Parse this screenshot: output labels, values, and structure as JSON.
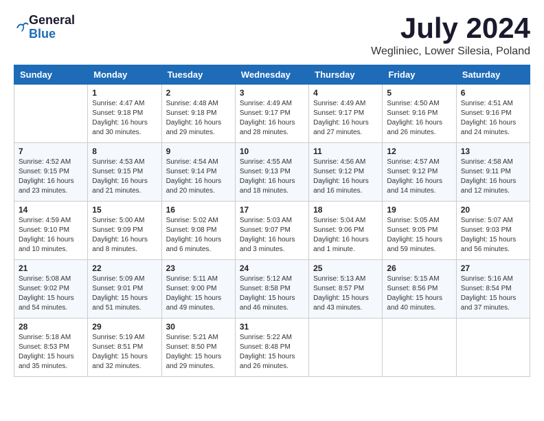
{
  "header": {
    "logo_general": "General",
    "logo_blue": "Blue",
    "month_year": "July 2024",
    "location": "Wegliniec, Lower Silesia, Poland"
  },
  "weekdays": [
    "Sunday",
    "Monday",
    "Tuesday",
    "Wednesday",
    "Thursday",
    "Friday",
    "Saturday"
  ],
  "weeks": [
    [
      {
        "day": "",
        "content": ""
      },
      {
        "day": "1",
        "content": "Sunrise: 4:47 AM\nSunset: 9:18 PM\nDaylight: 16 hours\nand 30 minutes."
      },
      {
        "day": "2",
        "content": "Sunrise: 4:48 AM\nSunset: 9:18 PM\nDaylight: 16 hours\nand 29 minutes."
      },
      {
        "day": "3",
        "content": "Sunrise: 4:49 AM\nSunset: 9:17 PM\nDaylight: 16 hours\nand 28 minutes."
      },
      {
        "day": "4",
        "content": "Sunrise: 4:49 AM\nSunset: 9:17 PM\nDaylight: 16 hours\nand 27 minutes."
      },
      {
        "day": "5",
        "content": "Sunrise: 4:50 AM\nSunset: 9:16 PM\nDaylight: 16 hours\nand 26 minutes."
      },
      {
        "day": "6",
        "content": "Sunrise: 4:51 AM\nSunset: 9:16 PM\nDaylight: 16 hours\nand 24 minutes."
      }
    ],
    [
      {
        "day": "7",
        "content": "Sunrise: 4:52 AM\nSunset: 9:15 PM\nDaylight: 16 hours\nand 23 minutes."
      },
      {
        "day": "8",
        "content": "Sunrise: 4:53 AM\nSunset: 9:15 PM\nDaylight: 16 hours\nand 21 minutes."
      },
      {
        "day": "9",
        "content": "Sunrise: 4:54 AM\nSunset: 9:14 PM\nDaylight: 16 hours\nand 20 minutes."
      },
      {
        "day": "10",
        "content": "Sunrise: 4:55 AM\nSunset: 9:13 PM\nDaylight: 16 hours\nand 18 minutes."
      },
      {
        "day": "11",
        "content": "Sunrise: 4:56 AM\nSunset: 9:12 PM\nDaylight: 16 hours\nand 16 minutes."
      },
      {
        "day": "12",
        "content": "Sunrise: 4:57 AM\nSunset: 9:12 PM\nDaylight: 16 hours\nand 14 minutes."
      },
      {
        "day": "13",
        "content": "Sunrise: 4:58 AM\nSunset: 9:11 PM\nDaylight: 16 hours\nand 12 minutes."
      }
    ],
    [
      {
        "day": "14",
        "content": "Sunrise: 4:59 AM\nSunset: 9:10 PM\nDaylight: 16 hours\nand 10 minutes."
      },
      {
        "day": "15",
        "content": "Sunrise: 5:00 AM\nSunset: 9:09 PM\nDaylight: 16 hours\nand 8 minutes."
      },
      {
        "day": "16",
        "content": "Sunrise: 5:02 AM\nSunset: 9:08 PM\nDaylight: 16 hours\nand 6 minutes."
      },
      {
        "day": "17",
        "content": "Sunrise: 5:03 AM\nSunset: 9:07 PM\nDaylight: 16 hours\nand 3 minutes."
      },
      {
        "day": "18",
        "content": "Sunrise: 5:04 AM\nSunset: 9:06 PM\nDaylight: 16 hours\nand 1 minute."
      },
      {
        "day": "19",
        "content": "Sunrise: 5:05 AM\nSunset: 9:05 PM\nDaylight: 15 hours\nand 59 minutes."
      },
      {
        "day": "20",
        "content": "Sunrise: 5:07 AM\nSunset: 9:03 PM\nDaylight: 15 hours\nand 56 minutes."
      }
    ],
    [
      {
        "day": "21",
        "content": "Sunrise: 5:08 AM\nSunset: 9:02 PM\nDaylight: 15 hours\nand 54 minutes."
      },
      {
        "day": "22",
        "content": "Sunrise: 5:09 AM\nSunset: 9:01 PM\nDaylight: 15 hours\nand 51 minutes."
      },
      {
        "day": "23",
        "content": "Sunrise: 5:11 AM\nSunset: 9:00 PM\nDaylight: 15 hours\nand 49 minutes."
      },
      {
        "day": "24",
        "content": "Sunrise: 5:12 AM\nSunset: 8:58 PM\nDaylight: 15 hours\nand 46 minutes."
      },
      {
        "day": "25",
        "content": "Sunrise: 5:13 AM\nSunset: 8:57 PM\nDaylight: 15 hours\nand 43 minutes."
      },
      {
        "day": "26",
        "content": "Sunrise: 5:15 AM\nSunset: 8:56 PM\nDaylight: 15 hours\nand 40 minutes."
      },
      {
        "day": "27",
        "content": "Sunrise: 5:16 AM\nSunset: 8:54 PM\nDaylight: 15 hours\nand 37 minutes."
      }
    ],
    [
      {
        "day": "28",
        "content": "Sunrise: 5:18 AM\nSunset: 8:53 PM\nDaylight: 15 hours\nand 35 minutes."
      },
      {
        "day": "29",
        "content": "Sunrise: 5:19 AM\nSunset: 8:51 PM\nDaylight: 15 hours\nand 32 minutes."
      },
      {
        "day": "30",
        "content": "Sunrise: 5:21 AM\nSunset: 8:50 PM\nDaylight: 15 hours\nand 29 minutes."
      },
      {
        "day": "31",
        "content": "Sunrise: 5:22 AM\nSunset: 8:48 PM\nDaylight: 15 hours\nand 26 minutes."
      },
      {
        "day": "",
        "content": ""
      },
      {
        "day": "",
        "content": ""
      },
      {
        "day": "",
        "content": ""
      }
    ]
  ]
}
